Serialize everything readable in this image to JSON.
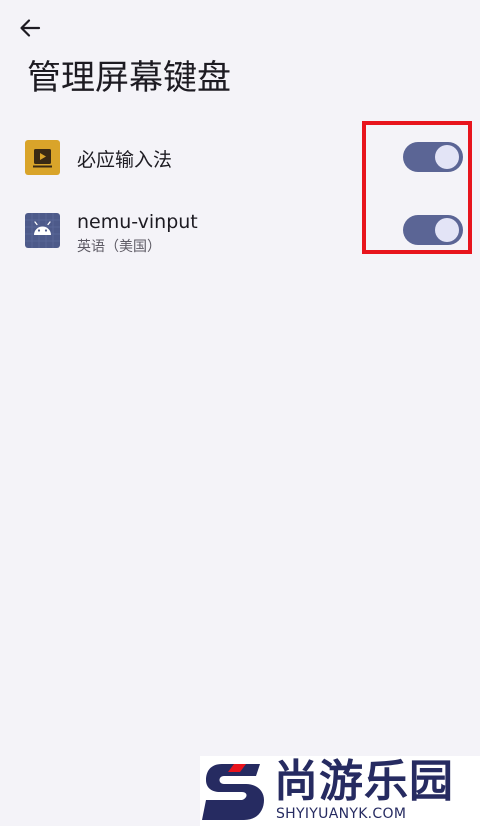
{
  "header": {
    "back_icon": "arrow-back-icon",
    "title": "管理屏幕键盘"
  },
  "keyboards": [
    {
      "name": "必应输入法",
      "subtitle": "",
      "icon": "bing-keyboard-icon",
      "icon_color": "#d9a42a",
      "enabled": true
    },
    {
      "name": "nemu-vinput",
      "subtitle": "英语（美国）",
      "icon": "android-robot-icon",
      "icon_color": "#4d5a8a",
      "enabled": true
    }
  ],
  "colors": {
    "background": "#f4f3f8",
    "toggle_track_on": "#5b6595",
    "toggle_knob": "#e3e4f6",
    "highlight_border": "#e8141d",
    "watermark_text": "#262b61",
    "watermark_accent": "#e8141d"
  },
  "watermark": {
    "title": "尚游乐园",
    "subtitle": "SHYIYUANYK.COM"
  }
}
